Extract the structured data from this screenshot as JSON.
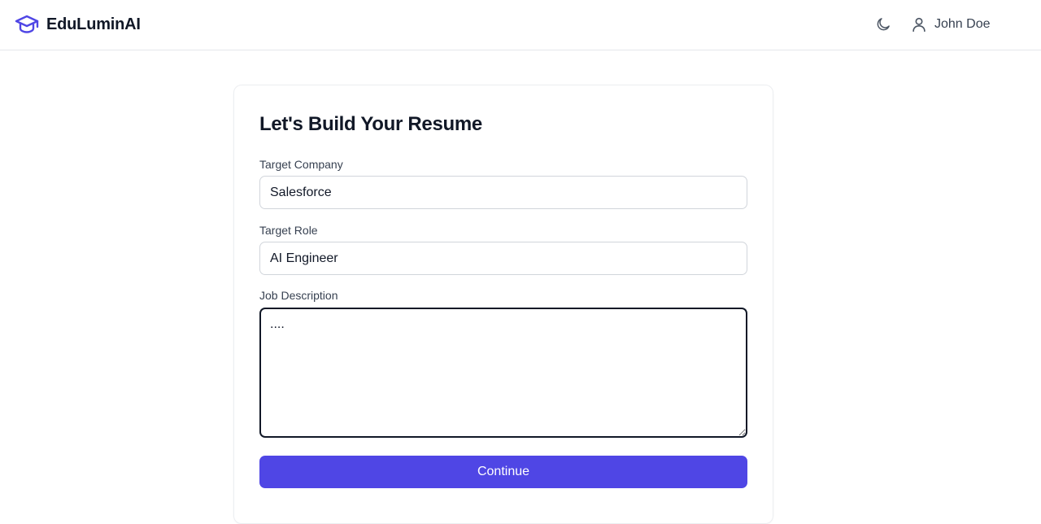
{
  "header": {
    "brand_name": "EduLuminAI",
    "brand_icon": "graduation-cap-icon",
    "theme_icon": "moon-icon",
    "user_icon": "user-icon",
    "user_name": "John Doe",
    "accent_color": "#4f46e5"
  },
  "form": {
    "title": "Let's Build Your Resume",
    "company": {
      "label": "Target Company",
      "value": "Salesforce"
    },
    "role": {
      "label": "Target Role",
      "value": "AI Engineer"
    },
    "description": {
      "label": "Job Description",
      "value": "...."
    },
    "submit_label": "Continue"
  }
}
